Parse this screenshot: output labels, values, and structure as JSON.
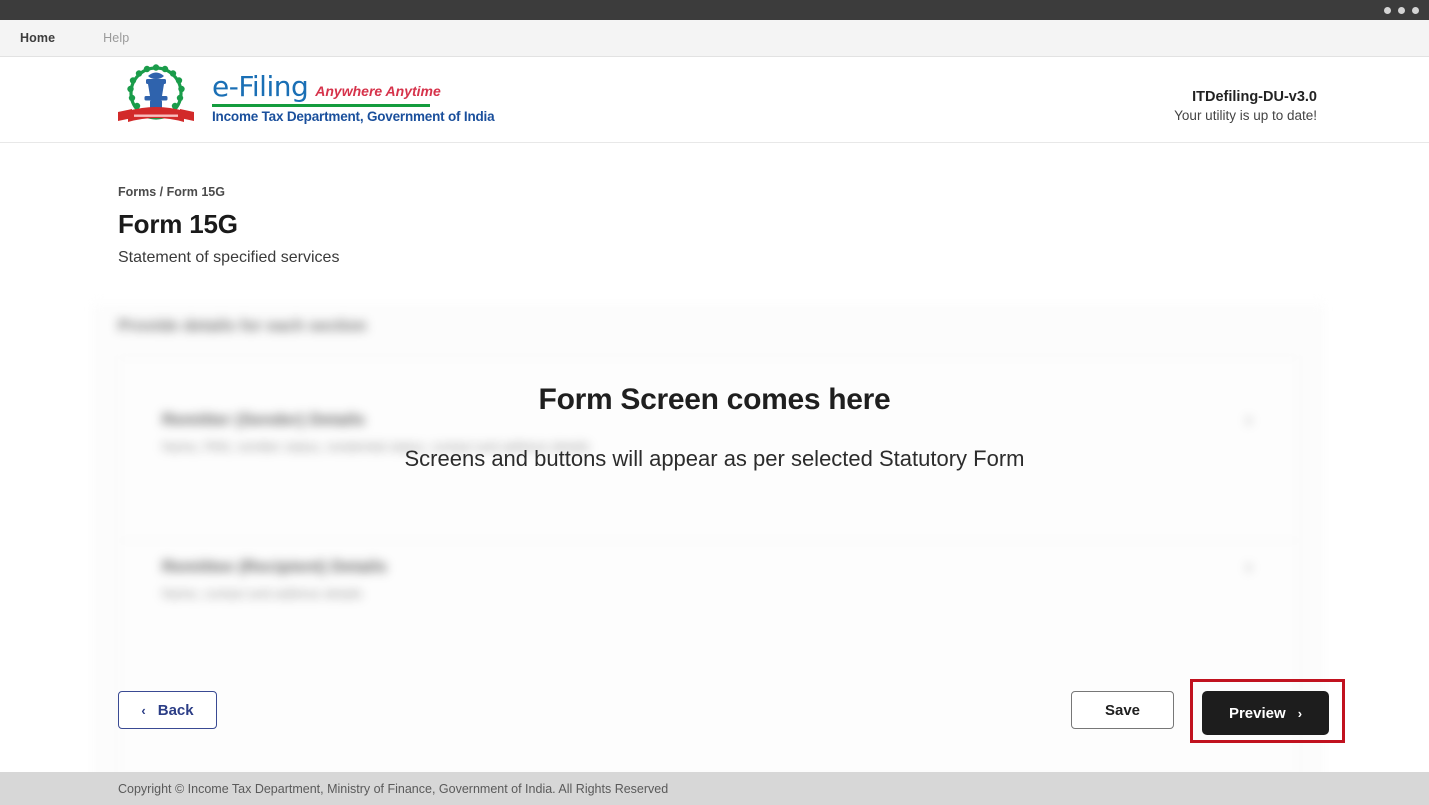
{
  "window": {
    "dots": [
      "dot",
      "dot",
      "dot"
    ]
  },
  "menubar": {
    "items": [
      {
        "label": "Home",
        "active": true
      },
      {
        "label": "Help",
        "active": false
      }
    ]
  },
  "brand": {
    "emblem_icon": "income-tax-department-emblem-icon",
    "name": "e-Filing",
    "tagline": "Anywhere Anytime",
    "department": "Income Tax Department, Government of India",
    "colors": {
      "efiling_blue": "#1a6fb5",
      "tagline_red": "#d6334b",
      "rule_green": "#149c3e",
      "department_blue": "#1a4f9c"
    }
  },
  "version": {
    "title": "ITDefiling-DU-v3.0",
    "subtitle": "Your utility is up to date!"
  },
  "page": {
    "breadcrumb": "Forms / Form 15G",
    "title": "Form 15G",
    "subtitle": "Statement of specified services"
  },
  "card": {
    "heading": "Provide details for each section",
    "sections": [
      {
        "title": "Remitter (Sender) Details",
        "description": "Name, PAN, remitter status, residential status, contact and address details",
        "chevron": "›"
      },
      {
        "title": "Remittee (Recipient) Details",
        "description": "Name, contact and address details",
        "chevron": "›"
      }
    ]
  },
  "overlay": {
    "title": "Form Screen comes here",
    "subtitle": "Screens and buttons will appear as per selected Statutory Form"
  },
  "actions": {
    "back_label": "Back",
    "back_chevron": "‹",
    "save_label": "Save",
    "preview_label": "Preview",
    "preview_chevron": "›",
    "highlight_color": "#c1121f"
  },
  "footer": {
    "copyright": "Copyright © Income Tax Department, Ministry of Finance, Government of India. All Rights Reserved"
  }
}
